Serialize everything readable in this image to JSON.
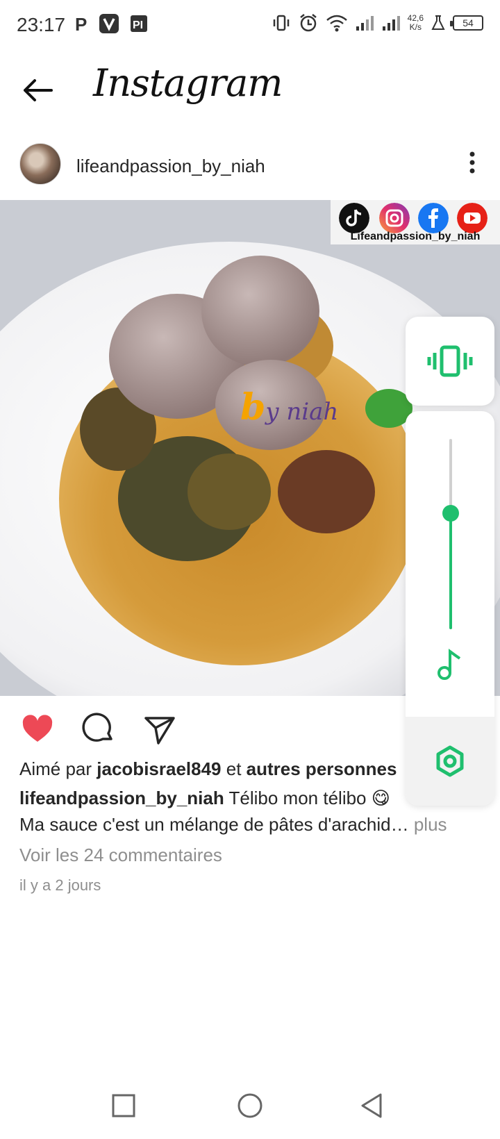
{
  "status_bar": {
    "time": "23:17",
    "net_speed_value": "42,6",
    "net_speed_unit": "K/s",
    "battery": "54"
  },
  "header": {
    "app_title": "Instagram"
  },
  "post": {
    "username": "lifeandpassion_by_niah",
    "image_overlay": {
      "social_label": "Lifeandpassion_by_niah",
      "watermark_b": "b",
      "watermark_text": "y niah"
    },
    "likes_prefix": "Aimé par",
    "liked_by_user": "jacobisrael849",
    "likes_connector": "et",
    "likes_others": "autres personnes",
    "caption_user": "lifeandpassion_by_niah",
    "caption_line1": "Télibo mon télibo 😋",
    "caption_line2": "Ma sauce c'est un mélange de pâtes d'arachid…",
    "more_label": "plus",
    "comments_link": "Voir les 24 commentaires",
    "timestamp": "il y a 2 jours",
    "liked": true
  },
  "volume_panel": {
    "mode": "vibrate",
    "media_volume_level": 0.61,
    "accent_color": "#1fbf6e"
  },
  "icons": {
    "back": "arrow-left-icon",
    "more": "vertical-dots-icon",
    "like": "heart-icon",
    "comment": "comment-bubble-icon",
    "share": "send-icon"
  },
  "colors": {
    "like_red": "#ed4956",
    "text_primary": "#262626",
    "text_secondary": "#8e8e8e"
  }
}
